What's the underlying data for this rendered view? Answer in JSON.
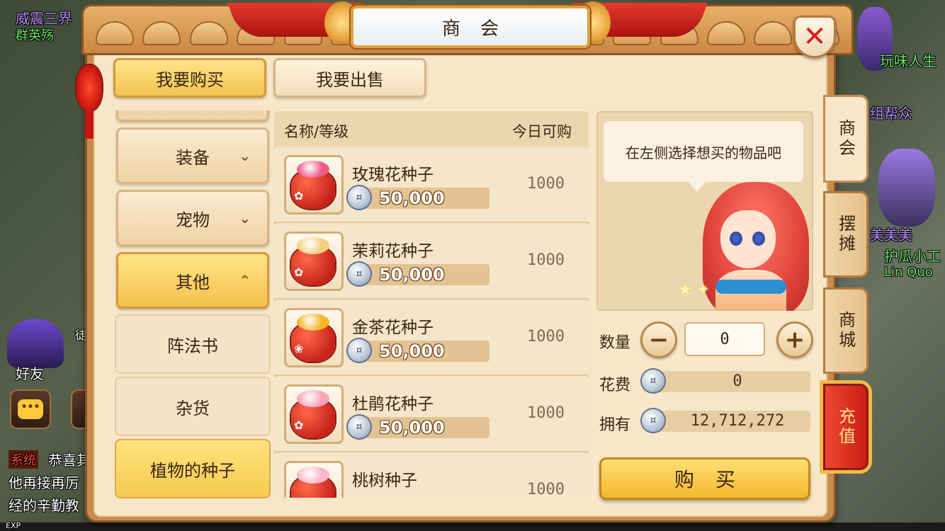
{
  "window_title": "商会",
  "top_tabs": {
    "buy": "我要购买",
    "sell": "我要出售"
  },
  "categories": [
    {
      "label": "装备",
      "state": "collapsed"
    },
    {
      "label": "宠物",
      "state": "collapsed"
    },
    {
      "label": "其他",
      "state": "expanded"
    }
  ],
  "subcategories": [
    {
      "label": "阵法书",
      "selected": false
    },
    {
      "label": "杂货",
      "selected": false
    },
    {
      "label": "植物的种子",
      "selected": true
    }
  ],
  "list_header": {
    "name": "名称/等级",
    "limit": "今日可购"
  },
  "items": [
    {
      "name": "玫瑰花种子",
      "price": "50,000",
      "limit": "1000",
      "seed_color": "#f05a8a",
      "flower": "✿"
    },
    {
      "name": "茉莉花种子",
      "price": "50,000",
      "limit": "1000",
      "seed_color": "#f3d07a",
      "flower": "✿"
    },
    {
      "name": "金茶花种子",
      "price": "50,000",
      "limit": "1000",
      "seed_color": "#f4b528",
      "flower": "❀"
    },
    {
      "name": "杜鹃花种子",
      "price": "50,000",
      "limit": "1000",
      "seed_color": "#f7a3b8",
      "flower": "✿"
    },
    {
      "name": "桃树种子",
      "price": "",
      "limit": "1000",
      "seed_color": "#f6b8c8",
      "flower": ""
    }
  ],
  "info": {
    "hint": "在左侧选择想买的物品吧"
  },
  "quantity": {
    "label": "数量",
    "value": "0"
  },
  "cost": {
    "label": "花费",
    "value": "0"
  },
  "owned": {
    "label": "拥有",
    "value": "12,712,272"
  },
  "buy_button": "购买",
  "side_tabs": [
    "商会",
    "摆摊",
    "商城",
    "充值"
  ],
  "background": {
    "player_name_1": "威震三界",
    "player_name_2": "群英殇",
    "right_name_1": "玩味人生",
    "right_name_2": "组帮众",
    "right_name_3": "美美美",
    "right_name_4": "护瓜小工",
    "right_name_5": "Lin Quo",
    "friend_label": "好友",
    "disciple_label": "徒",
    "system_tag": "系统",
    "chat_line_1": "恭喜其",
    "chat_line_2": "他再接再厉",
    "chat_line_3": "经的辛勤教",
    "exp_label": "EXP"
  },
  "colors": {
    "accent_gold": "#f2c14a",
    "panel_bg": "#f7e7c8",
    "frame": "#c98c4f",
    "close_red": "#e01b1b",
    "recharge_red": "#c81c12"
  }
}
